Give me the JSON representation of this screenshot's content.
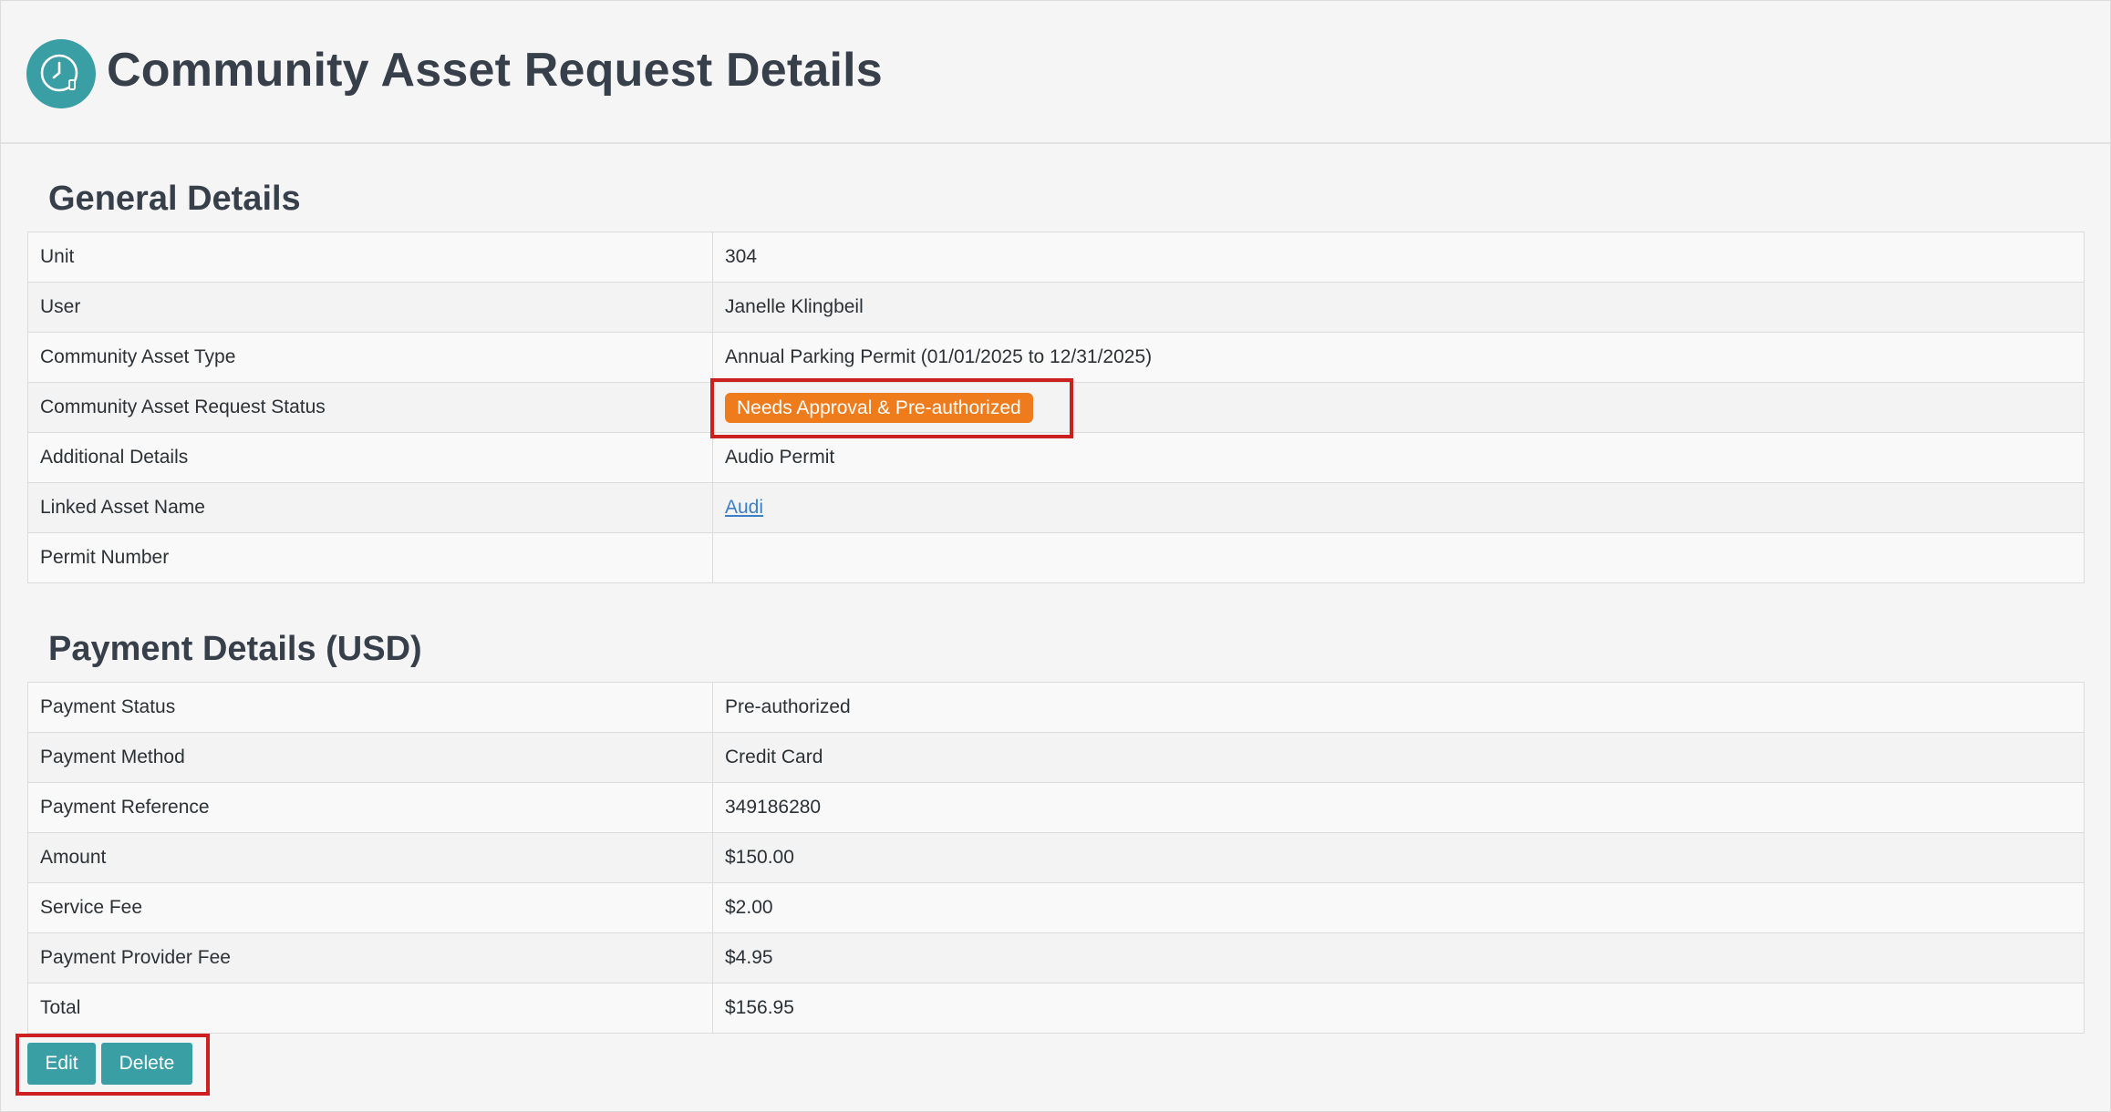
{
  "header": {
    "title": "Community Asset Request Details",
    "logo_icon": "clock-icon",
    "logo_color": "#3a9ea5"
  },
  "general": {
    "title": "General Details",
    "rows": [
      {
        "label": "Unit",
        "value": "304"
      },
      {
        "label": "User",
        "value": "Janelle Klingbeil"
      },
      {
        "label": "Community Asset Type",
        "value": "Annual Parking Permit (01/01/2025 to 12/31/2025)"
      },
      {
        "label": "Community Asset Request Status",
        "value": "Needs Approval & Pre-authorized"
      },
      {
        "label": "Additional Details",
        "value": "Audio Permit"
      },
      {
        "label": "Linked Asset Name",
        "value": "Audi"
      },
      {
        "label": "Permit Number",
        "value": ""
      }
    ],
    "status_color": "#ee7c1c"
  },
  "payment": {
    "title": "Payment Details (USD)",
    "rows": [
      {
        "label": "Payment Status",
        "value": "Pre-authorized"
      },
      {
        "label": "Payment Method",
        "value": "Credit Card"
      },
      {
        "label": "Payment Reference",
        "value": "349186280"
      },
      {
        "label": "Amount",
        "value": "$150.00"
      },
      {
        "label": "Service Fee",
        "value": "$2.00"
      },
      {
        "label": "Payment Provider Fee",
        "value": "$4.95"
      },
      {
        "label": "Total",
        "value": "$156.95"
      }
    ]
  },
  "actions": {
    "edit_label": "Edit",
    "delete_label": "Delete",
    "button_color": "#3a9ea5"
  },
  "highlight_color": "#cc1f1f"
}
